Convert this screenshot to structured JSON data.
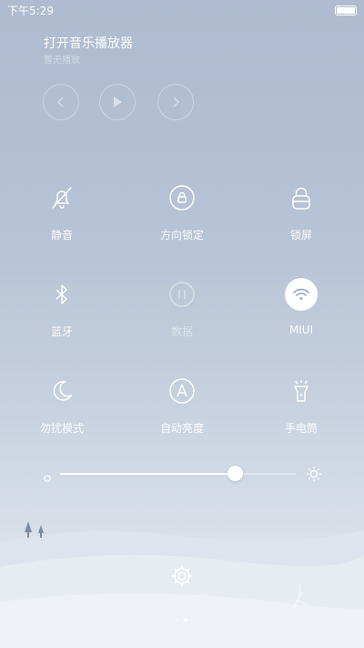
{
  "status_bar": {
    "time": "下午5:29",
    "battery_level": 1.0
  },
  "music": {
    "title": "打开音乐播放器",
    "subtitle": "暂无播放"
  },
  "toggles": [
    {
      "label": "静音",
      "icon": "bell-off-icon"
    },
    {
      "label": "方向锁定",
      "icon": "rotation-lock-icon"
    },
    {
      "label": "锁屏",
      "icon": "lock-icon"
    },
    {
      "label": "蓝牙",
      "icon": "bluetooth-icon"
    },
    {
      "label": "数据",
      "icon": "pause-circle-icon",
      "state": "disabled"
    },
    {
      "label": "MIUI",
      "icon": "wifi-icon",
      "state": "active"
    },
    {
      "label": "勿扰模式",
      "icon": "moon-icon"
    },
    {
      "label": "自动亮度",
      "icon": "auto-brightness-icon"
    },
    {
      "label": "手电筒",
      "icon": "flashlight-icon"
    }
  ],
  "brightness": {
    "value": 0.74
  },
  "pagination": {
    "current": 2,
    "total": 2
  },
  "colors": {
    "background_top": "#aebbd0",
    "background_bottom": "#e6eaf0",
    "accent": "#ffffff"
  }
}
